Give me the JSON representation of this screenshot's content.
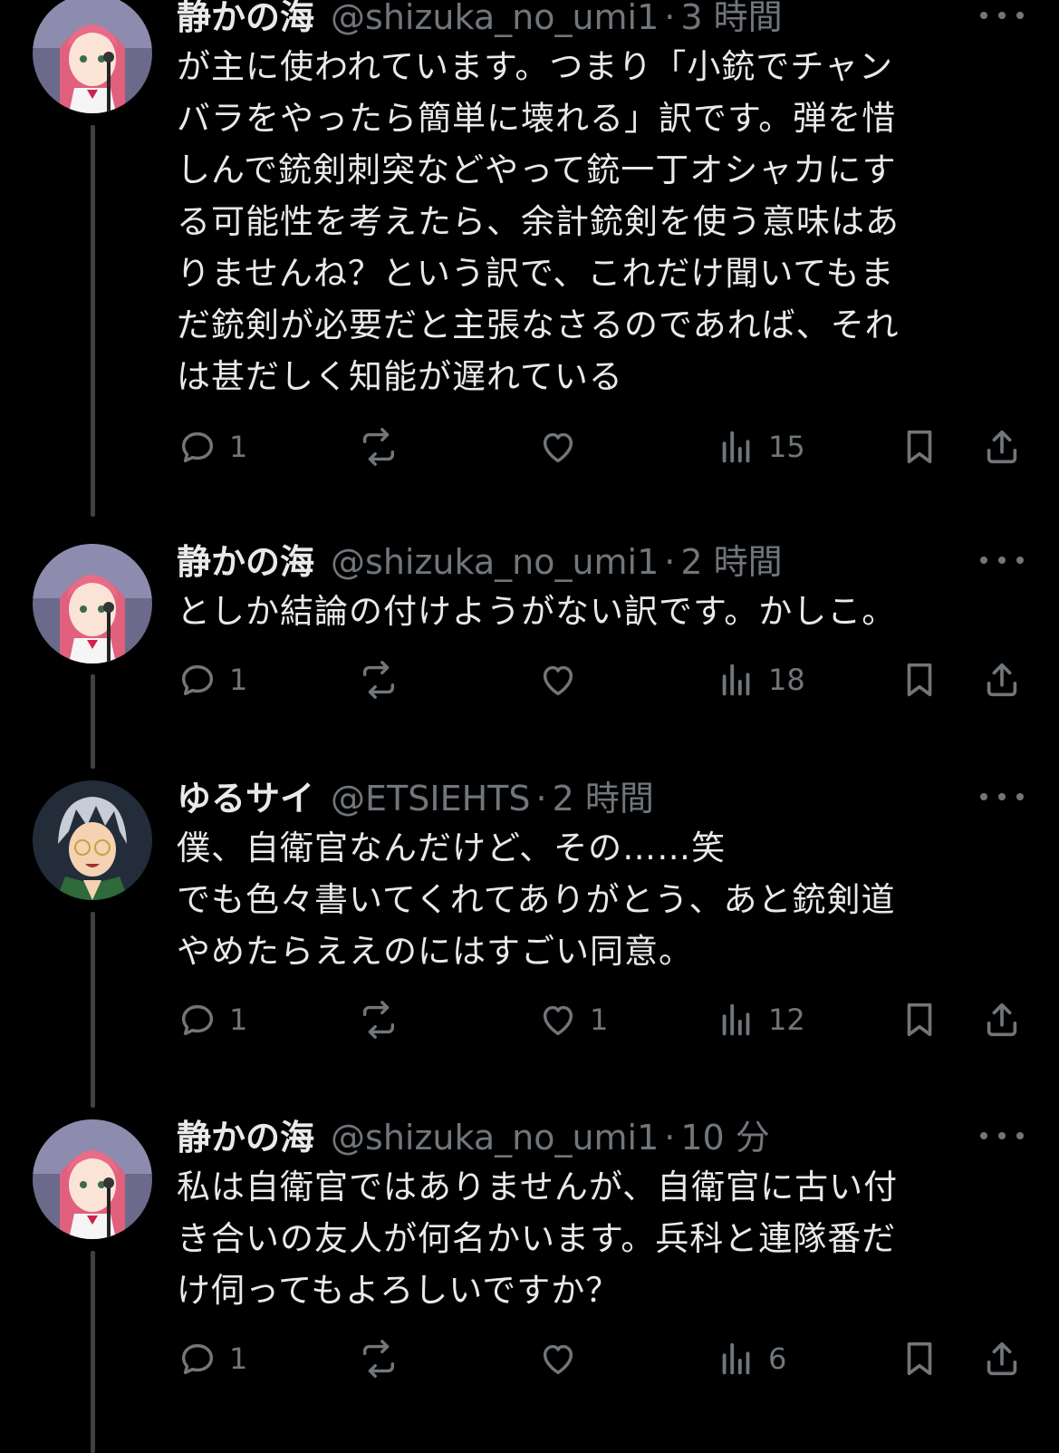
{
  "colors": {
    "background": "#000000",
    "text": "#e7e9ea",
    "muted": "#71767b",
    "thread_line": "#3e4144"
  },
  "tweets": [
    {
      "name": "静かの海",
      "handle": "@shizuka_no_umi1",
      "time": "3 時間",
      "avatar": "pink-hair-anime-avatar",
      "lines": [
        "が主に使われています。つまり「小銃でチャン",
        "バラをやったら簡単に壊れる」訳です。弾を惜",
        "しんで銃剣刺突などやって銃一丁オシャカにす",
        "る可能性を考えたら、余計銃剣を使う意味はあ",
        "りませんね？という訳で、これだけ聞いてもま",
        "だ銃剣が必要だと主張なさるのであれば、それ",
        "は甚だしく知能が遅れている"
      ],
      "replies": "1",
      "reposts": "",
      "likes": "",
      "views": "15"
    },
    {
      "name": "静かの海",
      "handle": "@shizuka_no_umi1",
      "time": "2 時間",
      "avatar": "pink-hair-anime-avatar",
      "lines": [
        "としか結論の付けようがない訳です。かしこ。"
      ],
      "replies": "1",
      "reposts": "",
      "likes": "",
      "views": "18"
    },
    {
      "name": "ゆるサイ",
      "handle": "@ETSIEHTS",
      "time": "2 時間",
      "avatar": "gray-hair-glasses-anime-avatar",
      "lines": [
        "僕、自衛官なんだけど、その……笑",
        "でも色々書いてくれてありがとう、あと銃剣道",
        "やめたらええのにはすごい同意。"
      ],
      "replies": "1",
      "reposts": "",
      "likes": "1",
      "views": "12"
    },
    {
      "name": "静かの海",
      "handle": "@shizuka_no_umi1",
      "time": "10 分",
      "avatar": "pink-hair-anime-avatar",
      "lines": [
        "私は自衛官ではありませんが、自衛官に古い付",
        "き合いの友人が何名かいます。兵科と連隊番だ",
        "け伺ってもよろしいですか？"
      ],
      "replies": "1",
      "reposts": "",
      "likes": "",
      "views": "6"
    }
  ]
}
